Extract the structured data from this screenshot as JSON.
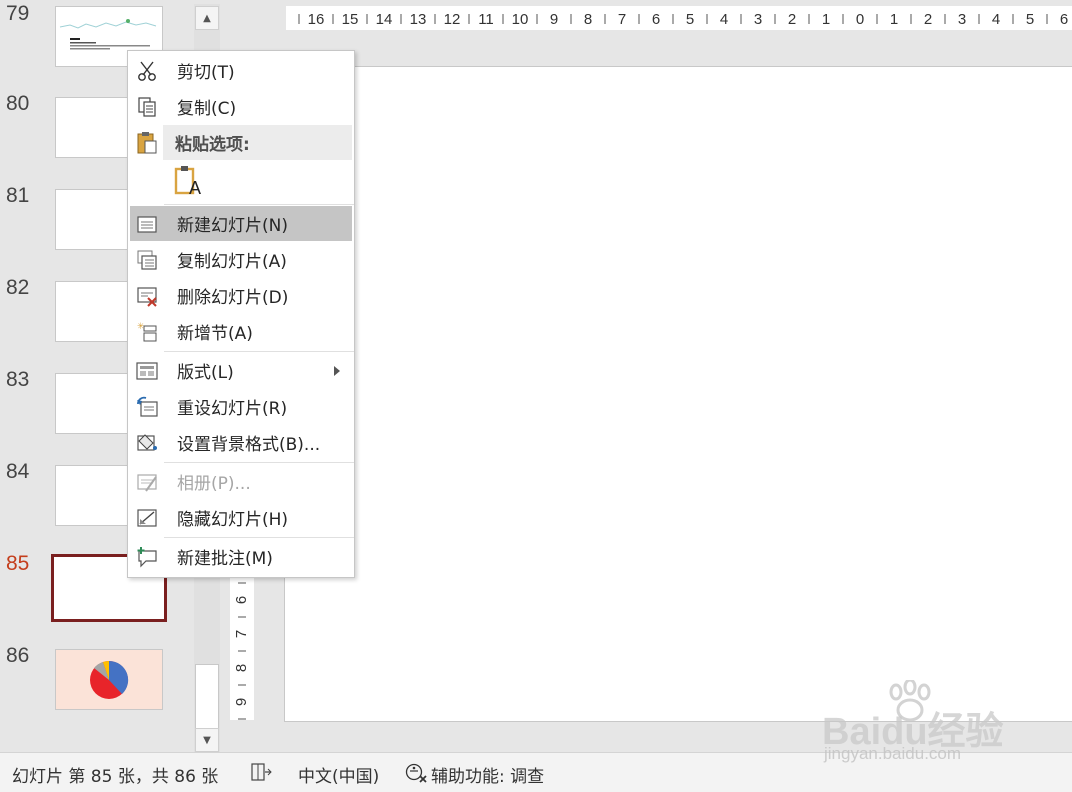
{
  "thumbnails": [
    {
      "number": "79"
    },
    {
      "number": "80"
    },
    {
      "number": "81"
    },
    {
      "number": "82"
    },
    {
      "number": "83"
    },
    {
      "number": "84"
    },
    {
      "number": "85"
    },
    {
      "number": "86"
    }
  ],
  "horizontal_ruler": [
    "16",
    "15",
    "14",
    "13",
    "12",
    "11",
    "10",
    "9",
    "8",
    "7",
    "6",
    "5",
    "4",
    "3",
    "2",
    "1",
    "0",
    "1",
    "2",
    "3",
    "4",
    "5",
    "6"
  ],
  "vertical_ruler": [
    "6",
    "7",
    "8",
    "9"
  ],
  "context_menu": {
    "cut": {
      "label": "剪切(T)",
      "icon": "scissors-icon"
    },
    "copy": {
      "label": "复制(C)",
      "icon": "copy-icon"
    },
    "paste_options": {
      "label": "粘贴选项:",
      "icon": "clipboard-icon"
    },
    "paste_text_only": {
      "icon": "paste-text-only-icon",
      "glyph": "A"
    },
    "new_slide": {
      "label": "新建幻灯片(N)",
      "icon": "new-slide-icon"
    },
    "duplicate_slide": {
      "label": "复制幻灯片(A)",
      "icon": "duplicate-slide-icon"
    },
    "delete_slide": {
      "label": "删除幻灯片(D)",
      "icon": "delete-slide-icon"
    },
    "add_section": {
      "label": "新增节(A)",
      "icon": "add-section-icon"
    },
    "layout": {
      "label": "版式(L)",
      "icon": "layout-icon"
    },
    "reset_slide": {
      "label": "重设幻灯片(R)",
      "icon": "reset-slide-icon"
    },
    "format_background": {
      "label": "设置背景格式(B)...",
      "icon": "format-background-icon"
    },
    "photo_album": {
      "label": "相册(P)...",
      "icon": "photo-album-icon"
    },
    "hide_slide": {
      "label": "隐藏幻灯片(H)",
      "icon": "hide-slide-icon"
    },
    "new_comment": {
      "label": "新建批注(M)",
      "icon": "new-comment-icon"
    }
  },
  "status_bar": {
    "slide_info": "幻灯片 第 85 张，共 86 张",
    "language": "中文(中国)",
    "accessibility": "辅助功能: 调查"
  },
  "watermark": {
    "text": "Baidu经验",
    "sub": "jingyan.baidu.com"
  },
  "colors": {
    "active_slide_number": "#c43e1c",
    "selected_thumbnail_border": "#7a1f1f",
    "menu_highlight": "#c5c5c5"
  }
}
